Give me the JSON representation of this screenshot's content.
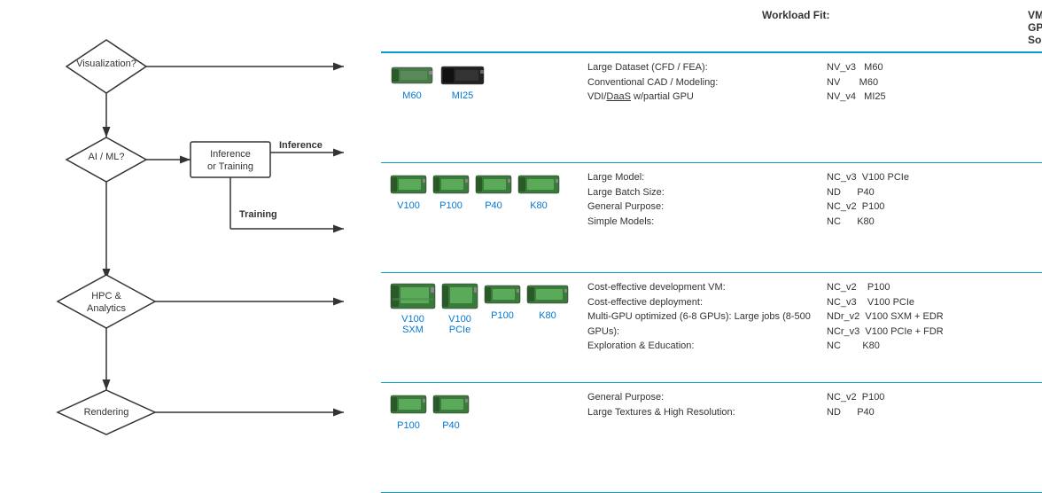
{
  "header": {
    "workload_label": "Workload Fit:",
    "vm_label": "VM / GPU Solution:"
  },
  "flowchart": {
    "nodes": [
      {
        "id": "visualization",
        "label": "Visualization?",
        "type": "diamond"
      },
      {
        "id": "aiml",
        "label": "AI / ML?",
        "type": "diamond"
      },
      {
        "id": "inference_training",
        "label": "Inference\nor Training",
        "type": "box"
      },
      {
        "id": "hpc",
        "label": "HPC &\nAnalytics",
        "type": "diamond"
      },
      {
        "id": "rendering",
        "label": "Rendering",
        "type": "diamond"
      }
    ],
    "labels": {
      "inference": "Inference",
      "training": "Training"
    }
  },
  "rows": [
    {
      "id": "visualization-row",
      "gpus": [
        {
          "label": "M60",
          "shape": "green-flat"
        },
        {
          "label": "MI25",
          "shape": "dark-flat"
        }
      ],
      "workload": [
        "Large Dataset (CFD / FEA):",
        "Conventional CAD / Modeling:",
        "VDI/DaaS w/partial GPU"
      ],
      "vm": [
        "NV_v3  M60",
        "NV      M60",
        "NV_v4  MI25"
      ]
    },
    {
      "id": "inference-row",
      "gpus": [
        {
          "label": "V100",
          "shape": "green-med"
        },
        {
          "label": "P100",
          "shape": "green-med"
        },
        {
          "label": "P40",
          "shape": "green-med"
        },
        {
          "label": "K80",
          "shape": "green-long"
        }
      ],
      "workload": [
        "Large Model:",
        "Large Batch Size:",
        "General Purpose:",
        "Simple Models:"
      ],
      "vm": [
        "NC_v3  V100 PCIe",
        "ND      P40",
        "NC_v2  P100",
        "NC      K80"
      ]
    },
    {
      "id": "training-row",
      "gpus": [
        {
          "label": "V100\nSXM",
          "shape": "green-large"
        },
        {
          "label": "V100\nPCIe",
          "shape": "green-med"
        },
        {
          "label": "P100",
          "shape": "green-med"
        },
        {
          "label": "K80",
          "shape": "green-long"
        }
      ],
      "workload": [
        "Cost-effective development VM:",
        "Cost-effective deployment:",
        "Multi-GPU optimized (6-8 GPUs): Large jobs (8-500 GPUs):",
        "Exploration & Education:"
      ],
      "vm": [
        "NC_v2    P100",
        "NC_v3    V100 PCIe",
        "NDr_v2  V100 SXM + EDR",
        "NCr_v3  V100 PCIe + FDR",
        "NC        K80"
      ]
    },
    {
      "id": "rendering-row",
      "gpus": [
        {
          "label": "P100",
          "shape": "green-med"
        },
        {
          "label": "P40",
          "shape": "green-med"
        }
      ],
      "workload": [
        "General Purpose:",
        "Large Textures & High Resolution:"
      ],
      "vm": [
        "NC_v2  P100",
        "ND      P40"
      ]
    }
  ]
}
